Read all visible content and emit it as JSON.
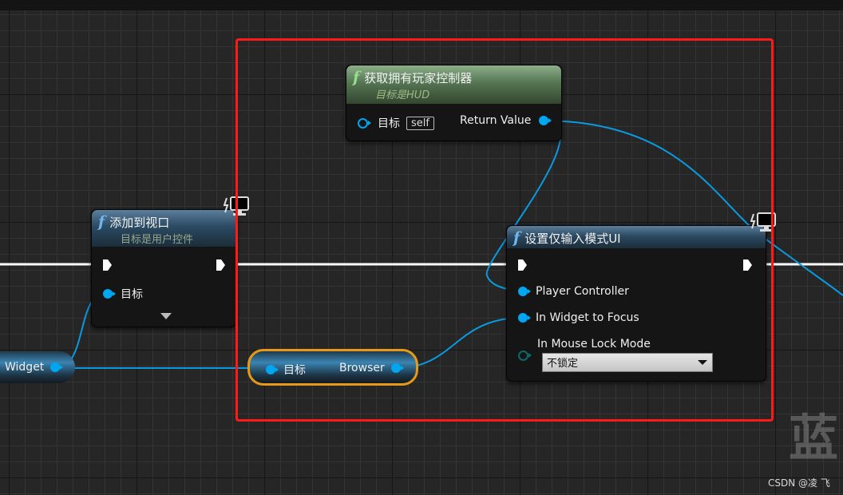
{
  "canvas": {
    "background": "#262626",
    "exec_wire_color": "#ffffff",
    "data_wire_color": "#0a9ae0",
    "highlight_box_color": "#ff1a1a"
  },
  "nodes": {
    "get_owning_player": {
      "icon": "function-icon",
      "fn_glyph": "f",
      "title": "获取拥有玩家控制器",
      "subtitle": "目标是HUD",
      "pins_in": [
        {
          "label": "目标",
          "default": "self",
          "type": "object-hollow"
        }
      ],
      "pins_out": [
        {
          "label": "Return Value",
          "type": "object"
        }
      ]
    },
    "add_to_viewport": {
      "icon": "function-icon",
      "fn_glyph": "f",
      "title": "添加到视口",
      "subtitle": "目标是用户控件",
      "pins_in": [
        {
          "label": "目标",
          "type": "object"
        }
      ],
      "badge": "client-only-monitor-icon",
      "expand_arrow": "chevron-down-icon"
    },
    "set_input_mode_ui": {
      "icon": "function-icon",
      "fn_glyph": "f",
      "title": "设置仅输入模式UI",
      "badge": "client-only-monitor-icon",
      "pins_in": [
        {
          "label": "Player Controller",
          "type": "object"
        },
        {
          "label": "In Widget to Focus",
          "type": "object"
        },
        {
          "label": "In Mouse Lock Mode",
          "type": "enum",
          "value": "不锁定"
        }
      ]
    },
    "widget_var": {
      "label": "Widget"
    },
    "browser_getter": {
      "in_label": "目标",
      "out_label": "Browser",
      "selected": true,
      "outline": "#e89a16"
    }
  },
  "watermark": {
    "char": "蓝",
    "credit": "CSDN @凌 飞"
  }
}
